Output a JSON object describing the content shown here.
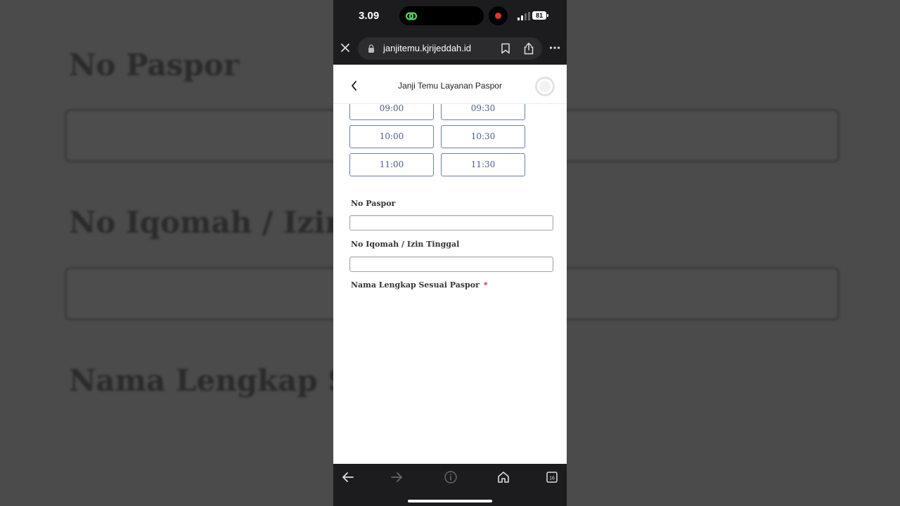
{
  "background": {
    "labels": [
      "No Paspor",
      "No Iqomah / Izin T",
      "Nama Lengkap Ses"
    ]
  },
  "status_bar": {
    "time": "3.09",
    "battery": "81"
  },
  "browser": {
    "url": "janjitemu.kjrijeddah.id"
  },
  "page": {
    "title": "Janji Temu Layanan Paspor",
    "time_slots": [
      "09:00",
      "09:30",
      "10:00",
      "10:30",
      "11:00",
      "11:30"
    ],
    "fields": {
      "passport_label": "No Paspor",
      "passport_value": "",
      "iqomah_label": "No Iqomah / Izin Tinggal",
      "iqomah_value": "",
      "fullname_label": "Nama Lengkap Sesuai Paspor",
      "required_marker": "*"
    }
  },
  "colors": {
    "slot_border": "#6c7fa2",
    "slot_text": "#4a5e86",
    "required": "#c0262d",
    "record": "#e5342b",
    "link_icon": "#4cd964"
  },
  "icons": [
    "link-icon",
    "record-icon",
    "signal-icon",
    "close-icon",
    "lock-icon",
    "bookmark-icon",
    "share-icon",
    "more-icon",
    "back-chevron-icon",
    "avatar-icon",
    "back-arrow-icon",
    "forward-arrow-icon",
    "reader-icon",
    "home-icon",
    "tabs-icon"
  ]
}
